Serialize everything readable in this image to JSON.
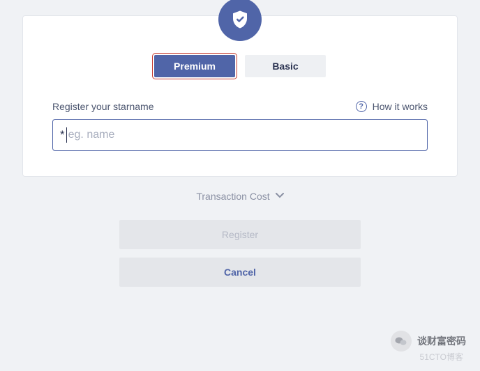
{
  "tabs": {
    "premium": "Premium",
    "basic": "Basic"
  },
  "form": {
    "label": "Register your starname",
    "help": "How it works",
    "prefix": "*",
    "placeholder": "eg. name",
    "value": ""
  },
  "transaction_cost": "Transaction Cost",
  "buttons": {
    "register": "Register",
    "cancel": "Cancel"
  },
  "watermark": {
    "name": "谈财富密码",
    "sub": "51CTO博客"
  }
}
